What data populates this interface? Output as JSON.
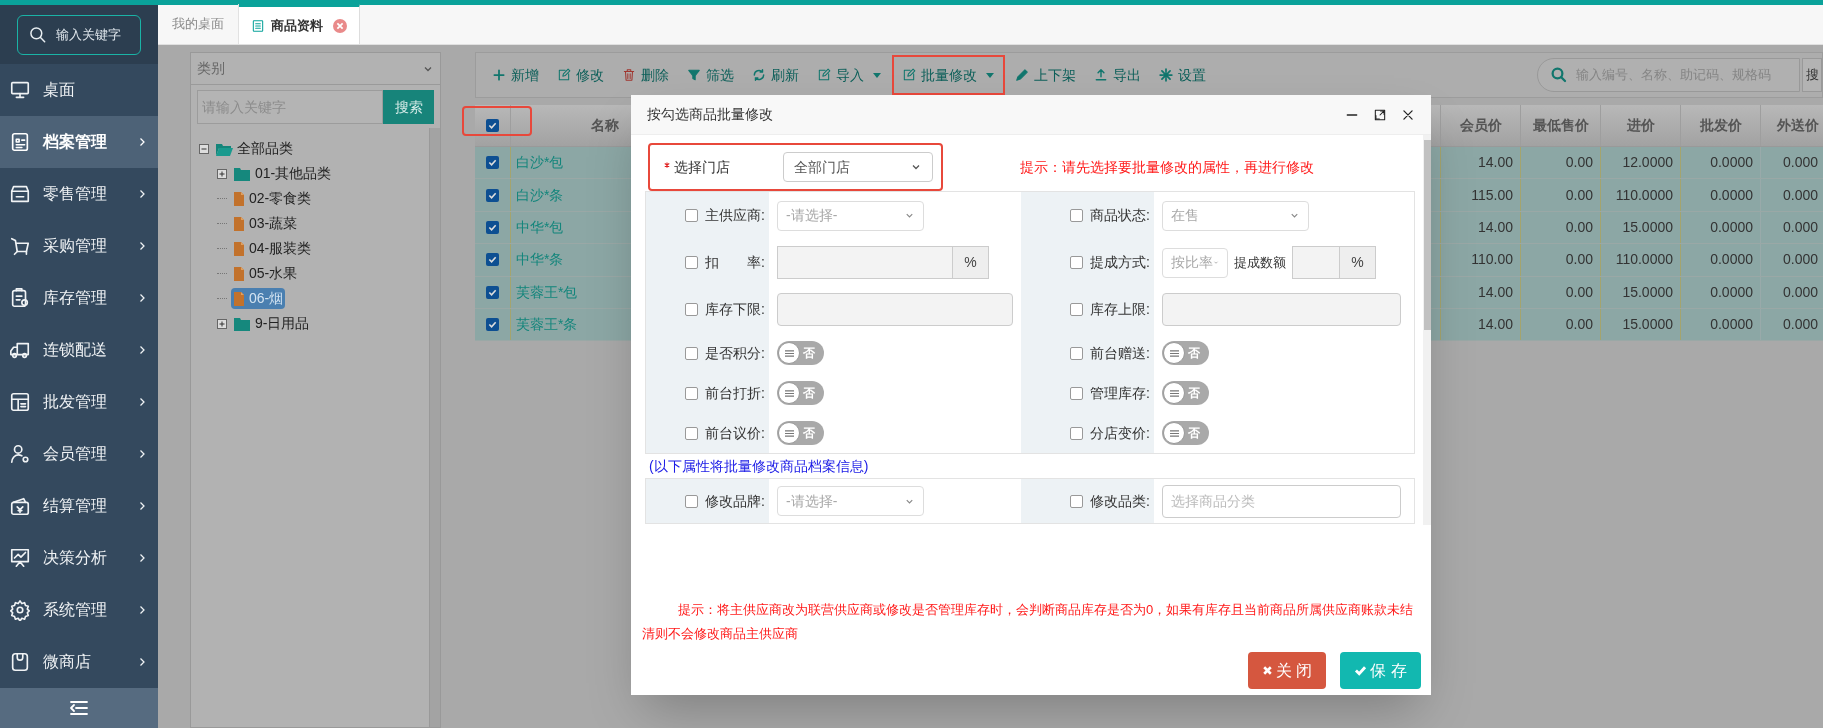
{
  "sidebar": {
    "search": {
      "label": "输入关键字"
    },
    "items": [
      {
        "label": "桌面",
        "selected": false,
        "expandable": false
      },
      {
        "label": "档案管理",
        "selected": true,
        "expandable": true
      },
      {
        "label": "零售管理",
        "selected": false,
        "expandable": true
      },
      {
        "label": "采购管理",
        "selected": false,
        "expandable": true
      },
      {
        "label": "库存管理",
        "selected": false,
        "expandable": true
      },
      {
        "label": "连锁配送",
        "selected": false,
        "expandable": true
      },
      {
        "label": "批发管理",
        "selected": false,
        "expandable": true
      },
      {
        "label": "会员管理",
        "selected": false,
        "expandable": true
      },
      {
        "label": "结算管理",
        "selected": false,
        "expandable": true
      },
      {
        "label": "决策分析",
        "selected": false,
        "expandable": true
      },
      {
        "label": "系统管理",
        "selected": false,
        "expandable": true
      },
      {
        "label": "微商店",
        "selected": false,
        "expandable": true
      }
    ]
  },
  "tabs": [
    {
      "label": "我的桌面",
      "selected": false,
      "closable": false
    },
    {
      "label": "商品资料",
      "selected": true,
      "closable": true
    }
  ],
  "category_panel": {
    "select": "类别",
    "search": {
      "placeholder": "请输入关键字",
      "button": "搜索"
    },
    "tree": [
      {
        "label": "全部品类",
        "kind": "folder",
        "expanded": true,
        "selected": false,
        "children": [
          {
            "label": "01-其他品类",
            "kind": "folder",
            "expanded": false,
            "selected": false
          },
          {
            "label": "02-零食类",
            "kind": "file",
            "selected": false
          },
          {
            "label": "03-蔬菜",
            "kind": "file",
            "selected": false
          },
          {
            "label": "04-服装类",
            "kind": "file",
            "selected": false
          },
          {
            "label": "05-水果",
            "kind": "file",
            "selected": false
          },
          {
            "label": "06-烟",
            "kind": "file",
            "selected": true
          },
          {
            "label": "9-日用品",
            "kind": "folder",
            "expanded": false,
            "selected": false
          }
        ]
      }
    ]
  },
  "toolbar": {
    "buttons": [
      {
        "label": "新增",
        "dropdown": false,
        "highlighted": false
      },
      {
        "label": "修改",
        "dropdown": false,
        "highlighted": false
      },
      {
        "label": "删除",
        "dropdown": false,
        "highlighted": false
      },
      {
        "label": "筛选",
        "dropdown": false,
        "highlighted": false
      },
      {
        "label": "刷新",
        "dropdown": false,
        "highlighted": false
      },
      {
        "label": "导入",
        "dropdown": true,
        "highlighted": false
      },
      {
        "label": "批量修改",
        "dropdown": true,
        "highlighted": true
      },
      {
        "label": "上下架",
        "dropdown": false,
        "highlighted": false
      },
      {
        "label": "导出",
        "dropdown": false,
        "highlighted": false
      },
      {
        "label": "设置",
        "dropdown": false,
        "highlighted": false
      }
    ],
    "search": {
      "placeholder": "输入编号、名称、助记码、规格码",
      "button": "搜"
    }
  },
  "table": {
    "header_checkbox": {
      "checked": true,
      "highlighted": true
    },
    "columns": [
      "名称",
      "会员价",
      "最低售价",
      "进价",
      "批发价",
      "外送价"
    ],
    "rows": [
      {
        "selected": true,
        "cells": [
          "白沙*包",
          "14.00",
          "0.00",
          "12.0000",
          "0.0000",
          "0.000"
        ]
      },
      {
        "selected": true,
        "cells": [
          "白沙*条",
          "115.00",
          "0.00",
          "110.0000",
          "0.0000",
          "0.000"
        ]
      },
      {
        "selected": true,
        "cells": [
          "中华*包",
          "14.00",
          "0.00",
          "15.0000",
          "0.0000",
          "0.000"
        ]
      },
      {
        "selected": true,
        "cells": [
          "中华*条",
          "110.00",
          "0.00",
          "110.0000",
          "0.0000",
          "0.000"
        ]
      },
      {
        "selected": true,
        "cells": [
          "芙蓉王*包",
          "14.00",
          "0.00",
          "15.0000",
          "0.0000",
          "0.000"
        ]
      },
      {
        "selected": true,
        "cells": [
          "芙蓉王*条",
          "14.00",
          "0.00",
          "15.0000",
          "0.0000",
          "0.000"
        ]
      }
    ]
  },
  "dialog": {
    "title": "按勾选商品批量修改",
    "store": {
      "label": "选择门店",
      "required": true,
      "value": "全部门店",
      "highlighted": true
    },
    "hint": "提示：请先选择要批量修改的属性，再进行修改",
    "fields": [
      {
        "kind": "select",
        "label": "主供应商:",
        "checked": false,
        "value": "-请选择-",
        "disabled": true
      },
      {
        "kind": "select",
        "label": "商品状态:",
        "checked": false,
        "value": "在售",
        "disabled": true
      },
      {
        "kind": "input_addon",
        "label": "扣　　率:",
        "checked": false,
        "addon": "%"
      },
      {
        "kind": "commission",
        "label": "提成方式:",
        "checked": false,
        "value": "按比率",
        "disabled": true,
        "sub_label": "提成数额",
        "addon": "%"
      },
      {
        "kind": "input",
        "label": "库存下限:",
        "checked": false
      },
      {
        "kind": "input",
        "label": "库存上限:",
        "checked": false
      },
      {
        "kind": "toggle",
        "label": "是否积分:",
        "checked": false,
        "on": false,
        "text": "否"
      },
      {
        "kind": "toggle",
        "label": "前台赠送:",
        "checked": false,
        "on": false,
        "text": "否"
      },
      {
        "kind": "toggle",
        "label": "前台打折:",
        "checked": false,
        "on": false,
        "text": "否"
      },
      {
        "kind": "toggle",
        "label": "管理库存:",
        "checked": false,
        "on": false,
        "text": "否"
      },
      {
        "kind": "toggle",
        "label": "前台议价:",
        "checked": false,
        "on": false,
        "text": "否"
      },
      {
        "kind": "toggle",
        "label": "分店变价:",
        "checked": false,
        "on": false,
        "text": "否"
      }
    ],
    "section_note": "(以下属性将批量修改商品档案信息)",
    "archive_fields": [
      {
        "kind": "select",
        "label": "修改品牌:",
        "checked": false,
        "value": "-请选择-",
        "disabled": true
      },
      {
        "kind": "input",
        "label": "修改品类:",
        "checked": false,
        "placeholder": "选择商品分类"
      }
    ],
    "footer_hint": "提示：将主供应商改为联营供应商或修改是否管理库存时，会判断商品库存是否为0，如果有库存且当前商品所属供应商账款未结清则不会修改商品主供应商",
    "buttons": [
      {
        "label": "关 闭",
        "kind": "close"
      },
      {
        "label": "保 存",
        "kind": "save"
      }
    ]
  }
}
